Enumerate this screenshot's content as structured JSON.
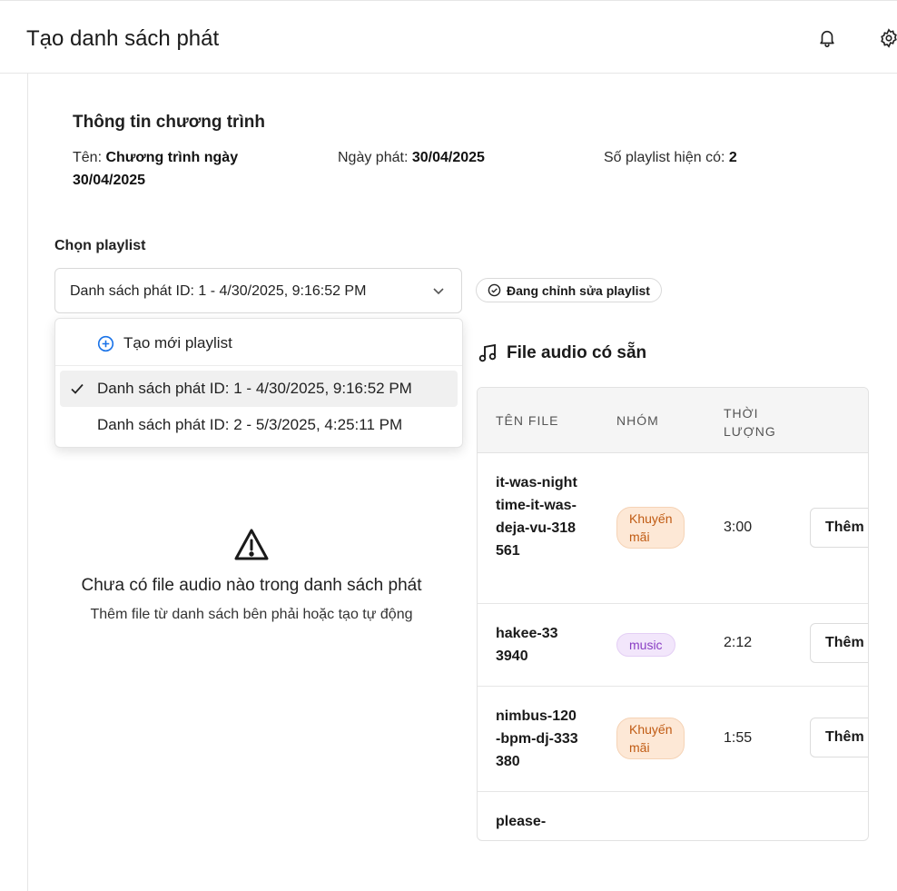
{
  "header": {
    "title": "Tạo danh sách phát",
    "notification_icon": "bell-icon",
    "settings_icon": "gear-icon"
  },
  "program_info": {
    "title": "Thông tin chương trình",
    "name_label": "Tên:",
    "name_value_line1": "Chương trình ngày",
    "name_value_line2": "30/04/2025",
    "date_label": "Ngày phát:",
    "date_value": "30/04/2025",
    "playlist_count_label": "Số playlist hiện có:",
    "playlist_count_value": "2"
  },
  "playlist_select": {
    "label": "Chọn playlist",
    "selected": "Danh sách phát ID: 1 - 4/30/2025, 9:16:52 PM",
    "editing_badge": "Đang chỉnh sửa playlist",
    "dropdown": {
      "create_label": "Tạo mới playlist",
      "options": [
        "Danh sách phát ID: 1 - 4/30/2025, 9:16:52 PM",
        "Danh sách phát ID: 2 - 5/3/2025, 4:25:11 PM"
      ]
    }
  },
  "empty_state": {
    "icon": "warning-icon",
    "title": "Chưa có file audio nào trong danh sách phát",
    "subtitle": "Thêm file từ danh sách bên phải hoặc tạo tự động"
  },
  "available_files": {
    "title": "File audio có sẵn",
    "icon": "music-note-icon",
    "columns": {
      "name": "TÊN FILE",
      "group": "NHÓM",
      "duration_line1": "THỜI",
      "duration_line2": "LƯỢNG"
    },
    "rows": [
      {
        "name": "it-was-nighttime-it-was-deja-vu-318561",
        "group_line1": "Khuyến",
        "group_line2": "mãi",
        "duration": "3:00",
        "action": "Thêm"
      },
      {
        "name": "hakee-333940",
        "group_line1": "music",
        "group_line2": "",
        "duration": "2:12",
        "action": "Thêm"
      },
      {
        "name": "nimbus-120-bpm-dj-333380",
        "group_line1": "Khuyến",
        "group_line2": "mãi",
        "duration": "1:55",
        "action": "Thêm"
      },
      {
        "name": "please-",
        "group_line1": "",
        "group_line2": "",
        "duration": "",
        "action": ""
      }
    ]
  },
  "colors": {
    "accent": "#1a73e8",
    "promo_bg": "#fde8d6",
    "promo_text": "#c05b13",
    "music_bg": "#f2e6fb",
    "music_text": "#8a3fc4"
  }
}
